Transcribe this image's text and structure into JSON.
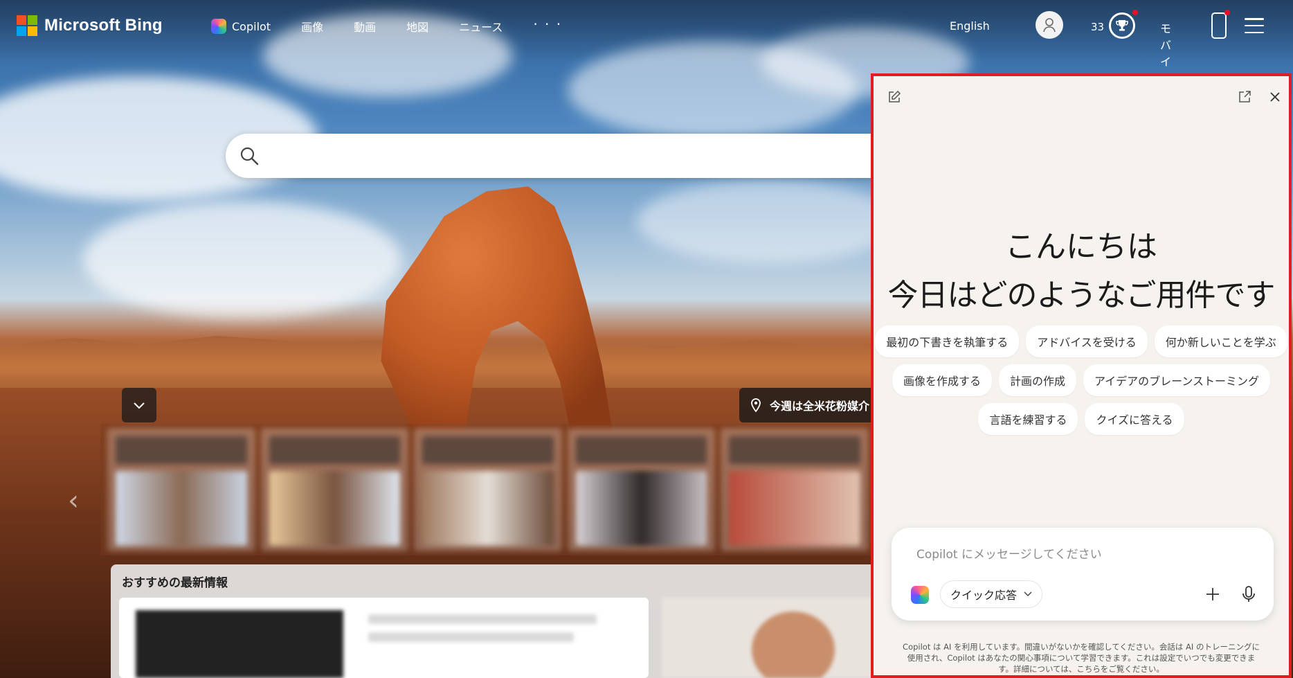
{
  "brand": {
    "logo_text": "Microsoft Bing",
    "logo_colors": [
      "#f25022",
      "#7fba00",
      "#00a4ef",
      "#ffb900"
    ]
  },
  "nav": {
    "items": [
      {
        "label": "Copilot",
        "icon": "copilot-icon"
      },
      {
        "label": "画像"
      },
      {
        "label": "動画"
      },
      {
        "label": "地図"
      },
      {
        "label": "ニュース"
      },
      {
        "label": "· · ·"
      }
    ]
  },
  "header_right": {
    "language": "English",
    "points": "33",
    "mobile_label": "モバイル"
  },
  "search": {
    "placeholder": "",
    "value": ""
  },
  "info_pill": {
    "text": "今週は全米花粉媒介"
  },
  "feed": {
    "title": "おすすめの最新情報"
  },
  "copilot": {
    "greeting_line1": "こんにちは",
    "greeting_line2": "今日はどのようなご用件ですか?",
    "suggestions": [
      [
        "最初の下書きを執筆する",
        "アドバイスを受ける",
        "何か新しいことを学ぶ"
      ],
      [
        "画像を作成する",
        "計画の作成",
        "アイデアのブレーンストーミング"
      ],
      [
        "言語を練習する",
        "クイズに答える"
      ]
    ],
    "composer_placeholder": "Copilot にメッセージしてください",
    "mode_label": "クイック応答",
    "disclaimer": "Copilot は AI を利用しています。間違いがないかを確認してください。会話は AI のトレーニングに使用され、Copilot はあなたの関心事項について学習できます。これは設定でいつでも変更できます。詳細については、こちらをご覧ください。"
  },
  "colors": {
    "panel_border": "#e11d1d",
    "panel_bg": "#f6f3ef",
    "notification_dot": "#e81123"
  }
}
